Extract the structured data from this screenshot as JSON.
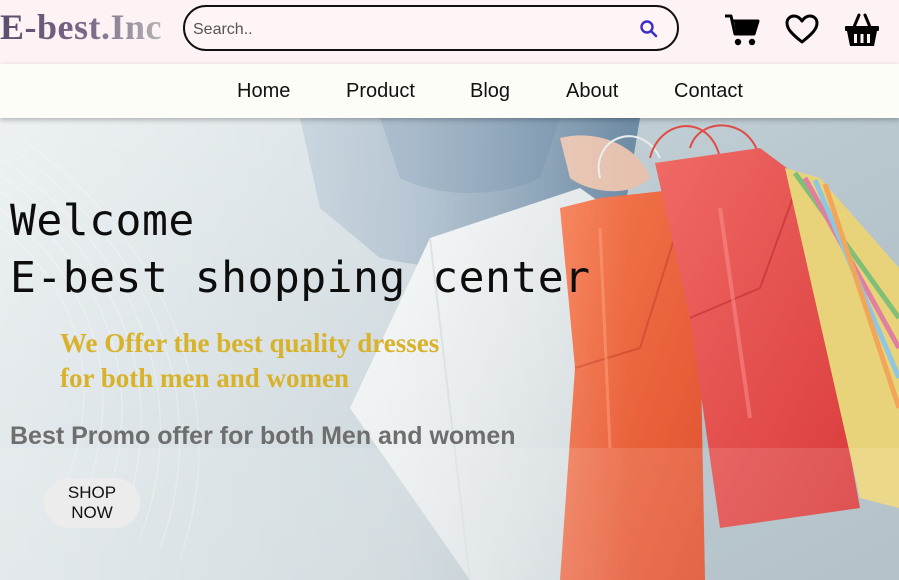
{
  "header": {
    "logo": "E-best.Inc",
    "search": {
      "placeholder": "Search.."
    },
    "icons": [
      "cart-icon",
      "heart-icon",
      "basket-icon"
    ]
  },
  "nav": {
    "items": [
      {
        "label": "Home"
      },
      {
        "label": "Product"
      },
      {
        "label": "Blog"
      },
      {
        "label": "About"
      },
      {
        "label": "Contact"
      }
    ]
  },
  "hero": {
    "welcome": "Welcome",
    "headline": "E-best shopping center",
    "offer_line1": "We Offer the best quality dresses",
    "offer_line2": "for both men and women",
    "promo": "Best Promo offer for both Men and women",
    "cta_line1": "SHOP",
    "cta_line2": "NOW"
  },
  "colors": {
    "topbar_bg": "#fdf3f4",
    "nav_bg": "#fdfdf7",
    "offer_text": "#d8b22a",
    "promo_text": "#6e6e6e",
    "search_icon": "#3b2fc9",
    "bag_red": "#e4453b",
    "bag_orange": "#f0663e"
  }
}
